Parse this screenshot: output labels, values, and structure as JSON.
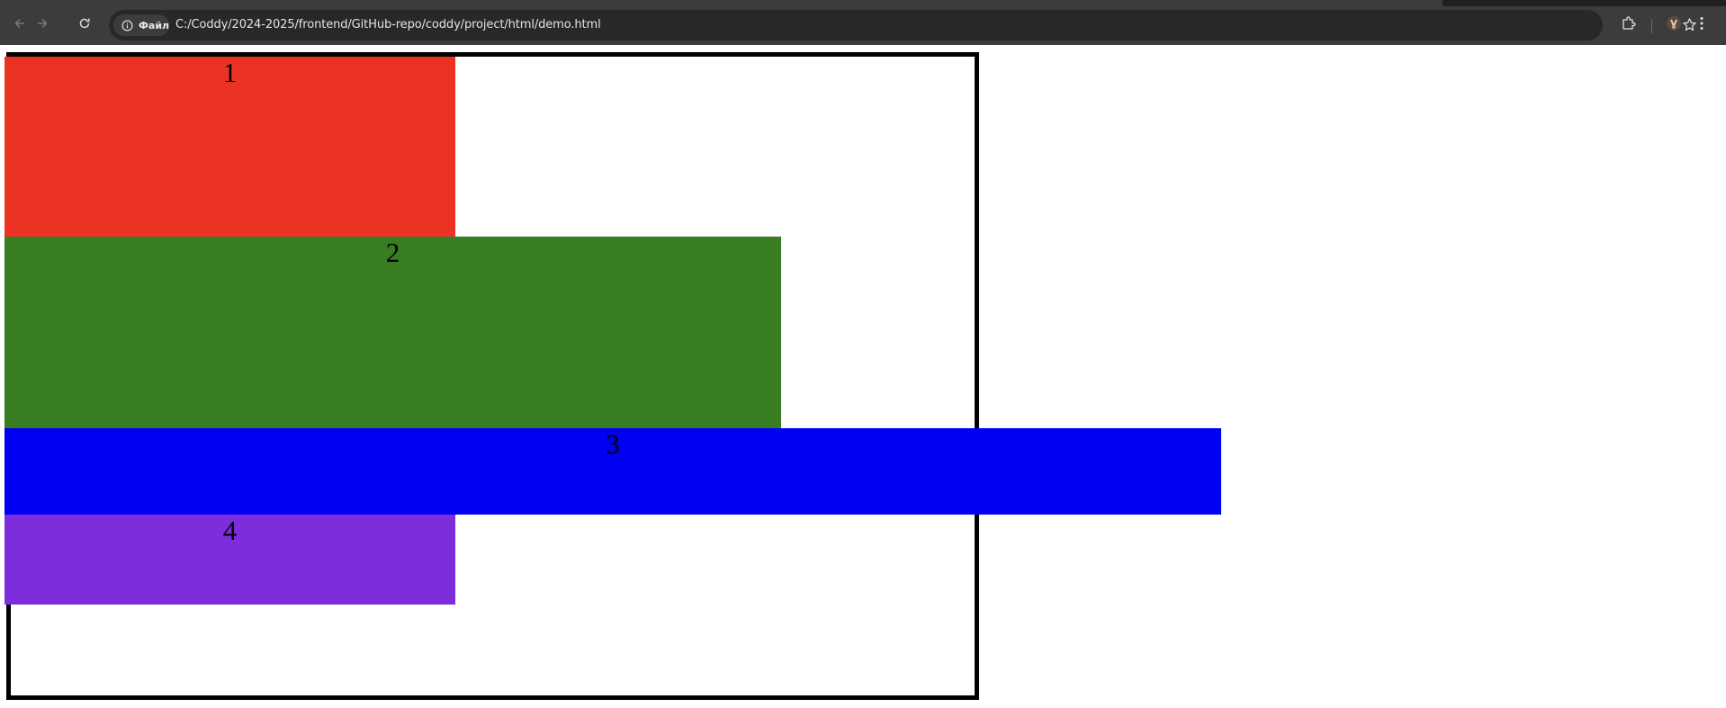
{
  "browser": {
    "site_chip_label": "Файл",
    "url": "C:/Coddy/2024-2025/frontend/GitHub-repo/coddy/project/html/demo.html",
    "icons": [
      "back-arrow-icon",
      "forward-arrow-icon",
      "reload-icon",
      "info-icon",
      "star-icon",
      "extensions-icon",
      "profile-icon",
      "kebab-menu-icon"
    ]
  },
  "blocks": [
    {
      "label": "1",
      "color": "#ec3323"
    },
    {
      "label": "2",
      "color": "#387d22"
    },
    {
      "label": "3",
      "color": "#0000f5"
    },
    {
      "label": "4",
      "color": "#7d2ddb"
    }
  ],
  "container": {
    "border_color": "#000000"
  }
}
